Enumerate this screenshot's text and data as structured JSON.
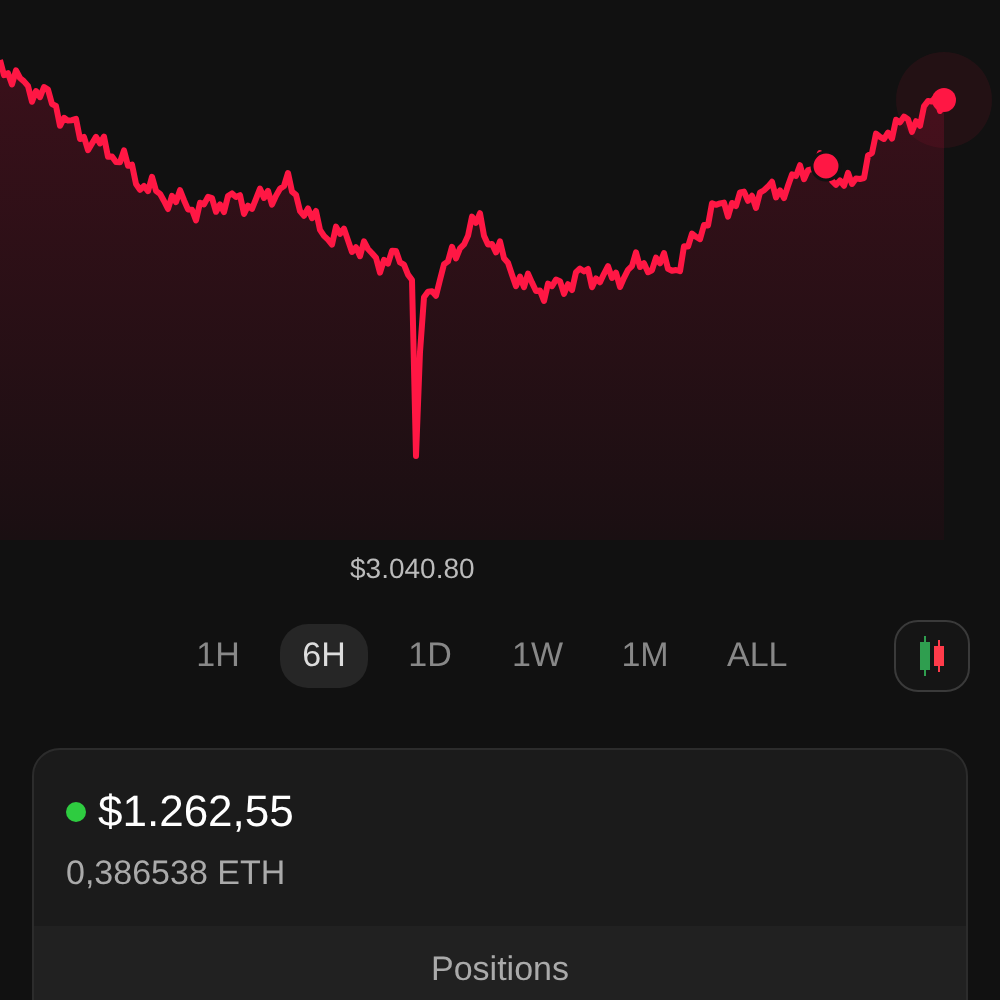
{
  "chart": {
    "price_label": "$3.040.80"
  },
  "periods": [
    {
      "label": "1H",
      "selected": false
    },
    {
      "label": "6H",
      "selected": true
    },
    {
      "label": "1D",
      "selected": false
    },
    {
      "label": "1W",
      "selected": false
    },
    {
      "label": "1M",
      "selected": false
    },
    {
      "label": "ALL",
      "selected": false
    }
  ],
  "balance": {
    "value": "$1.262,55",
    "color": "#2ecc40",
    "amount": "0,386538 ETH"
  },
  "section_tab": "Positions"
}
